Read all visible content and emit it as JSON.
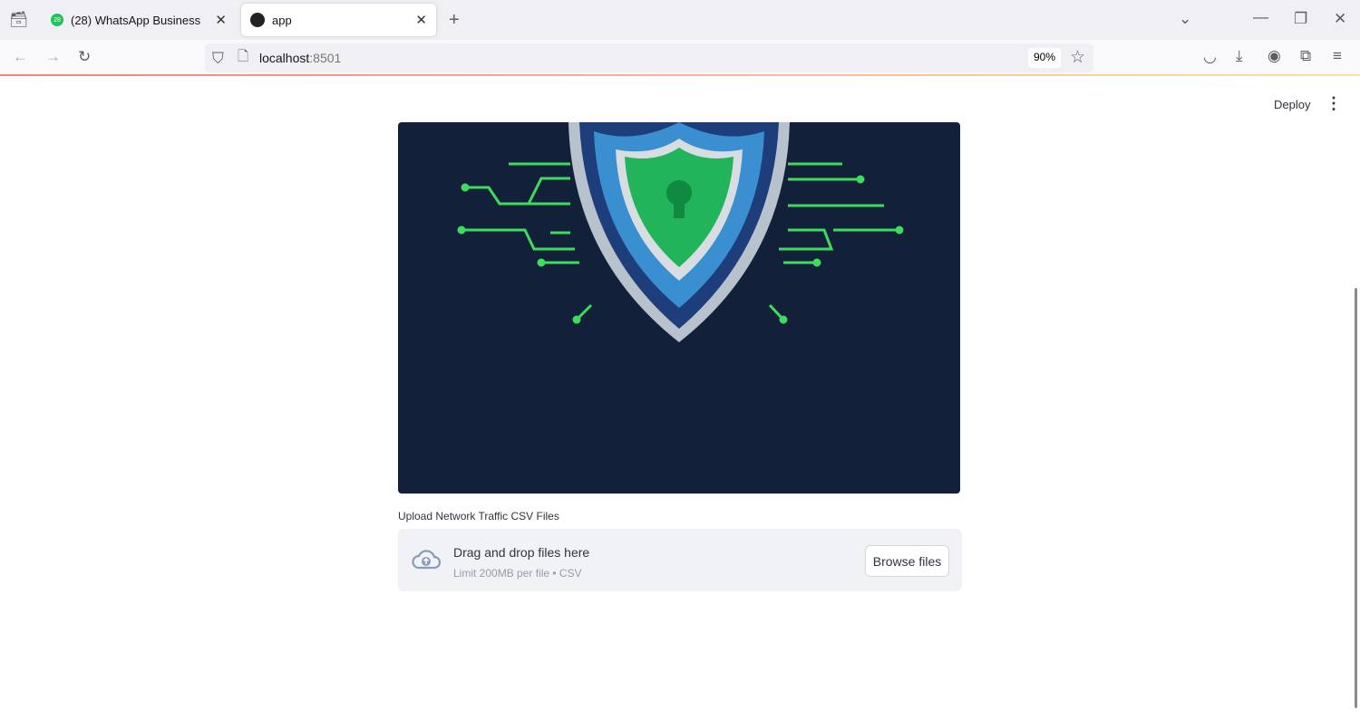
{
  "browser": {
    "tabs": [
      {
        "label": "(28) WhatsApp Business",
        "badge": "28"
      },
      {
        "label": "app"
      }
    ],
    "url_host": "localhost",
    "url_port": ":8501",
    "zoom": "90%"
  },
  "app": {
    "deploy_label": "Deploy",
    "uploader": {
      "label": "Upload Network Traffic CSV Files",
      "title": "Drag and drop files here",
      "hint": "Limit 200MB per file • CSV",
      "browse_label": "Browse files"
    }
  },
  "colors": {
    "hero_bg": "#13203a",
    "circuit": "#3ddc5a",
    "accent_red": "#f2837a"
  }
}
